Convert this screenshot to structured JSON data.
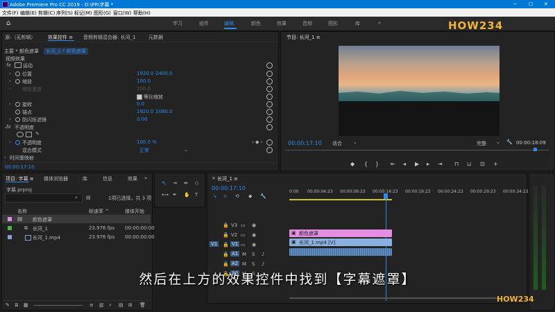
{
  "titlebar": {
    "title": "Adobe Premiere Pro CC 2019 - D:\\PR\\字幕 *",
    "min": "─",
    "max": "☐",
    "close": "✕"
  },
  "menu": [
    "文件(F)",
    "编辑(E)",
    "剪辑(C)",
    "序列(S)",
    "标记(M)",
    "图形(G)",
    "窗口(W)",
    "帮助(H)"
  ],
  "workspace": {
    "items": [
      "学习",
      "组件",
      "编辑",
      "颜色",
      "效果",
      "音频",
      "图形",
      "库"
    ],
    "active": "编辑",
    "more": "»"
  },
  "logo": "HOW234",
  "effect_controls": {
    "tabs": [
      "源:（无剪辑）",
      "效果控件 ≡",
      "音频剪辑混合器: 长河_1",
      "元数据"
    ],
    "master": "主要 * 颜色遮罩",
    "clip": "长河_1 * 颜色遮罩",
    "section": "视频效果",
    "motion": "运动",
    "rows": [
      {
        "label": "位置",
        "v1": "1920.0",
        "v2": "2400.0"
      },
      {
        "label": "缩放",
        "v1": "100.0",
        "v2": ""
      },
      {
        "label": "缩放宽度",
        "v1": "100.0",
        "v2": ""
      },
      {
        "label": "等比缩放",
        "v1": "",
        "v2": ""
      },
      {
        "label": "旋转",
        "v1": "0.0",
        "v2": ""
      },
      {
        "label": "锚点",
        "v1": "1920.0",
        "v2": "1080.0"
      },
      {
        "label": "防闪烁滤镜",
        "v1": "0.00",
        "v2": ""
      }
    ],
    "opacity": "不透明度",
    "opacity_label": "不透明度",
    "opacity_value": "100.0 %",
    "blend_label": "混合模式",
    "blend_value": "正常",
    "time_remap": "时间重映射",
    "timecode": "00:00:17:10"
  },
  "program": {
    "title": "节目: 长河_1 ≡",
    "timecode": "00:00:17:10",
    "fit": "适合",
    "quality": "完整",
    "duration": "00:00:18:09"
  },
  "project": {
    "tabs": [
      "项目: 字幕 ≡",
      "媒体浏览器",
      "库",
      "信息",
      "效果"
    ],
    "file": "字幕.prproj",
    "selection": "1项已选择，共 3 项",
    "col_name": "名称",
    "col_fps": "帧速率 ^",
    "col_start": "媒体开始",
    "items": [
      {
        "name": "颜色遮罩",
        "fps": "",
        "start": "",
        "color": "#e38ee0"
      },
      {
        "name": "长河_1",
        "fps": "23.976 fps",
        "start": "00:00:00:00",
        "color": "#4db34d"
      },
      {
        "name": "长河_1.mp4",
        "fps": "23.976 fps",
        "start": "00:00:00:00",
        "color": "#8aa0d8"
      }
    ]
  },
  "timeline": {
    "title": "长河_1 ≡",
    "timecode": "00:00:17:10",
    "ruler": [
      "0:00",
      "00:00:04:23",
      "00:00:09:23",
      "00:00:14:23",
      "00:00:19:23",
      "00:00:24:23",
      "00:00:29:23",
      "00:00:34:23"
    ],
    "tracks": [
      "V3",
      "V2",
      "V1",
      "A1",
      "A2",
      "A3"
    ],
    "source_track": "V1",
    "clip_v3": "颜色遮罩",
    "clip_v2": "长河_1.mp4 [V]"
  },
  "subtitle": "然后在上方的效果控件中找到【字幕遮罩】",
  "watermark": "HOW234",
  "colors": {
    "accent": "#2d8ceb",
    "titlebar": "#0078d7",
    "mask_clip": "#e38ee0",
    "video_clip": "#8ab0e0",
    "audio_clip": "#4a76a8"
  }
}
